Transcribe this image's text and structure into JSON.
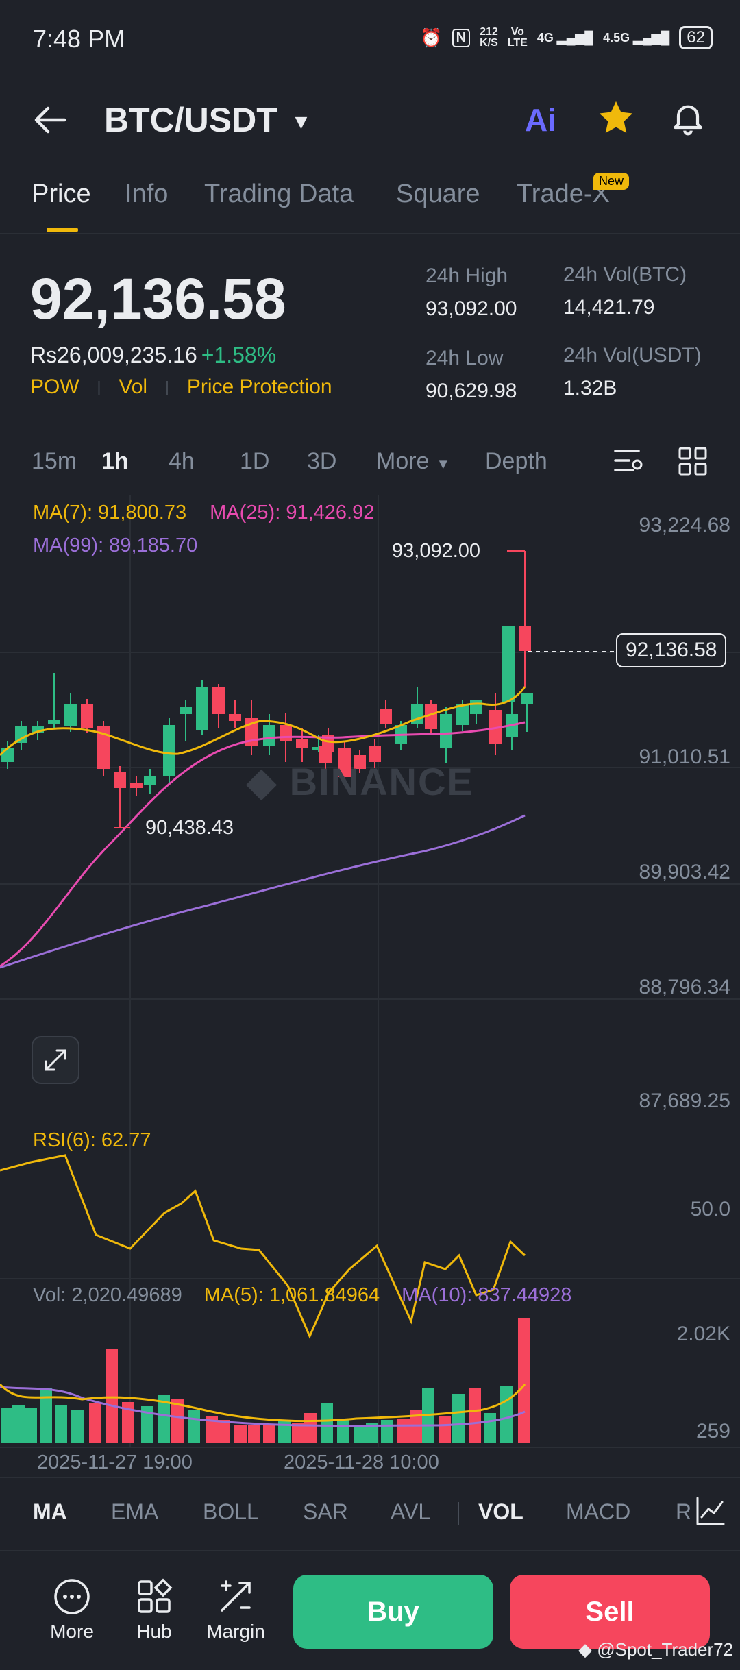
{
  "status": {
    "time": "7:48 PM",
    "speed_top": "212",
    "speed_bottom": "K/S",
    "volte_top": "Vo",
    "volte_bottom": "LTE",
    "net1": "4G",
    "net2": "4.5G",
    "battery": "62"
  },
  "header": {
    "pair": "BTC/USDT",
    "ai_label": "Ai"
  },
  "tabs": [
    {
      "label": "Price"
    },
    {
      "label": "Info"
    },
    {
      "label": "Trading Data"
    },
    {
      "label": "Square"
    },
    {
      "label": "Trade-X"
    }
  ],
  "tab_badge": "New",
  "ticker": {
    "price": "92,136.58",
    "inr_price": "Rs26,009,235.16",
    "change": "+1.58%",
    "tags": [
      "POW",
      "Vol",
      "Price Protection"
    ],
    "high_label": "24h High",
    "high_value": "93,092.00",
    "low_label": "24h Low",
    "low_value": "90,629.98",
    "vol_btc_label": "24h Vol(BTC)",
    "vol_btc_value": "14,421.79",
    "vol_usdt_label": "24h Vol(USDT)",
    "vol_usdt_value": "1.32B"
  },
  "timeframes": [
    "15m",
    "1h",
    "4h",
    "1D",
    "3D",
    "More",
    "Depth"
  ],
  "active_timeframe": "1h",
  "chart": {
    "ma7": "MA(7): 91,800.73",
    "ma25": "MA(25): 91,426.92",
    "ma99": "MA(99): 89,185.70",
    "high_marker": "93,092.00",
    "low_marker": "90,438.43",
    "current_price_tag": "92,136.58",
    "axis": [
      "93,224.68",
      "91,010.51",
      "89,903.42",
      "88,796.34",
      "87,689.25"
    ],
    "watermark": "BINANCE",
    "rsi": "RSI(6): 62.77",
    "rsi_axis": "50.0",
    "vol": "Vol: 2,020.49689",
    "vol_ma5": "MA(5): 1,061.84964",
    "vol_ma10": "MA(10): 837.44928",
    "vol_axis_top": "2.02K",
    "vol_axis_bottom": "259",
    "time_labels": [
      "2025-11-27 19:00",
      "2025-11-28 10:00"
    ]
  },
  "chart_data": {
    "type": "candlestick",
    "series": [
      {
        "name": "MA(7)",
        "last": 91800.73
      },
      {
        "name": "MA(25)",
        "last": 91426.92
      },
      {
        "name": "MA(99)",
        "last": 89185.7
      }
    ],
    "high": 93092.0,
    "low": 90438.43,
    "last": 92136.58,
    "ylim": [
      87689.25,
      93224.68
    ]
  },
  "indicators": [
    "MA",
    "EMA",
    "BOLL",
    "SAR",
    "AVL",
    "VOL",
    "MACD",
    "R"
  ],
  "bottom": {
    "more": "More",
    "hub": "Hub",
    "margin": "Margin",
    "buy": "Buy",
    "sell": "Sell",
    "watermark": "@Spot_Trader72"
  },
  "colors": {
    "up": "#2ebd85",
    "down": "#f6465d",
    "accent": "#f0b90b",
    "ma25": "#e84bb0",
    "ma99": "#9b6fd8"
  }
}
